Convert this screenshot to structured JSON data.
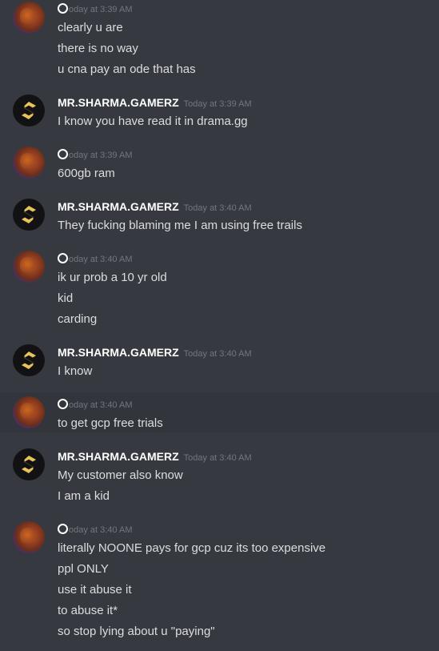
{
  "messages": [
    {
      "author": "",
      "timestamp": "oday at 3:39 AM",
      "avatar": "user-avatar",
      "lines": [
        "clearly u are",
        "there is no way",
        "u cna pay an ode that has"
      ]
    },
    {
      "author": "MR.SHARMA.GAMERZ",
      "timestamp": "Today at 3:39 AM",
      "avatar": "sharma-avatar",
      "lines": [
        "I know you have read it in drama.gg"
      ]
    },
    {
      "author": "",
      "timestamp": "oday at 3:39 AM",
      "avatar": "user-avatar",
      "lines": [
        "600gb ram"
      ]
    },
    {
      "author": "MR.SHARMA.GAMERZ",
      "timestamp": "Today at 3:40 AM",
      "avatar": "sharma-avatar",
      "lines": [
        "They fucking blaming me I am using free trails"
      ]
    },
    {
      "author": "",
      "timestamp": "oday at 3:40 AM",
      "avatar": "user-avatar",
      "lines": [
        "ik ur prob a 10 yr old",
        "kid",
        "carding"
      ]
    },
    {
      "author": "MR.SHARMA.GAMERZ",
      "timestamp": "Today at 3:40 AM",
      "avatar": "sharma-avatar",
      "lines": [
        "I know"
      ]
    },
    {
      "author": "",
      "timestamp": "oday at 3:40 AM",
      "avatar": "user-avatar",
      "lines": [
        "to get gcp free trials"
      ]
    },
    {
      "author": "MR.SHARMA.GAMERZ",
      "timestamp": "Today at 3:40 AM",
      "avatar": "sharma-avatar",
      "lines": [
        "My customer also know",
        "I am a kid"
      ]
    },
    {
      "author": "",
      "timestamp": "oday at 3:40 AM",
      "avatar": "user-avatar",
      "lines": [
        "literally NOONE pays for gcp cuz its too expensive",
        "ppl ONLY",
        "use it abuse it",
        "to abuse it*",
        "so stop lying about u \"paying\""
      ]
    }
  ],
  "colors": {
    "background": "#36393f",
    "text": "#dcddde",
    "username": "#ffffff",
    "timestamp": "#72767d",
    "sharma_logo": "#e7c35a"
  }
}
